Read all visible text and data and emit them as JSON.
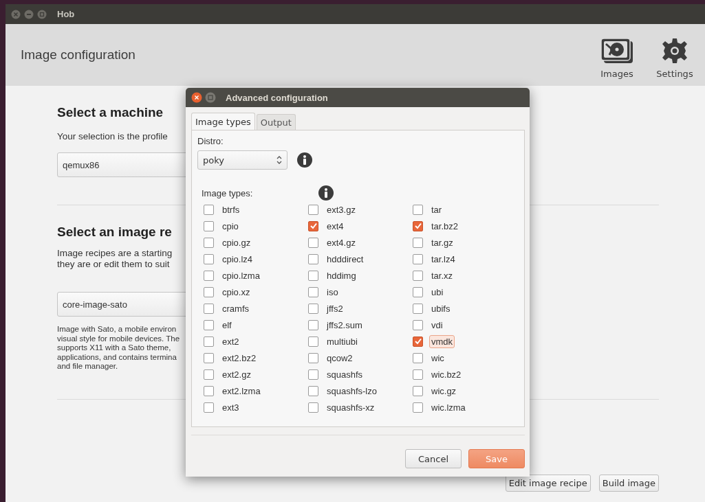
{
  "window": {
    "title": "Hob"
  },
  "header": {
    "title": "Image configuration",
    "tools": [
      {
        "label": "Images",
        "kind": "images"
      },
      {
        "label": "Settings",
        "kind": "settings"
      }
    ]
  },
  "machine": {
    "heading": "Select a machine",
    "text": "Your selection is the profile",
    "value": "qemux86"
  },
  "recipe": {
    "heading": "Select an image re",
    "text_lines": [
      "Image recipes are a starting",
      "they are or edit them to suit"
    ],
    "value": "core-image-sato",
    "description_lines": [
      "Image with Sato, a mobile environ",
      "visual style for mobile devices. The",
      "supports X11 with a Sato theme,",
      "applications, and contains termina",
      "and file manager."
    ]
  },
  "buttons": [
    "Edit image recipe",
    "Build image"
  ],
  "dialog": {
    "title": "Advanced configuration",
    "tabs": [
      {
        "label": "Image types",
        "selected": true
      },
      {
        "label": "Output",
        "selected": false
      }
    ],
    "distro_label": "Distro:",
    "distro": "poky",
    "image_types_label": "Image types:",
    "image_types": [
      {
        "label": "btrfs",
        "checked": false,
        "focused": false
      },
      {
        "label": "cpio",
        "checked": false,
        "focused": false
      },
      {
        "label": "cpio.gz",
        "checked": false,
        "focused": false
      },
      {
        "label": "cpio.lz4",
        "checked": false,
        "focused": false
      },
      {
        "label": "cpio.lzma",
        "checked": false,
        "focused": false
      },
      {
        "label": "cpio.xz",
        "checked": false,
        "focused": false
      },
      {
        "label": "cramfs",
        "checked": false,
        "focused": false
      },
      {
        "label": "elf",
        "checked": false,
        "focused": false
      },
      {
        "label": "ext2",
        "checked": false,
        "focused": false
      },
      {
        "label": "ext2.bz2",
        "checked": false,
        "focused": false
      },
      {
        "label": "ext2.gz",
        "checked": false,
        "focused": false
      },
      {
        "label": "ext2.lzma",
        "checked": false,
        "focused": false
      },
      {
        "label": "ext3",
        "checked": false,
        "focused": false
      },
      {
        "label": "ext3.gz",
        "checked": false,
        "focused": false
      },
      {
        "label": "ext4",
        "checked": true,
        "focused": false
      },
      {
        "label": "ext4.gz",
        "checked": false,
        "focused": false
      },
      {
        "label": "hdddirect",
        "checked": false,
        "focused": false
      },
      {
        "label": "hddimg",
        "checked": false,
        "focused": false
      },
      {
        "label": "iso",
        "checked": false,
        "focused": false
      },
      {
        "label": "jffs2",
        "checked": false,
        "focused": false
      },
      {
        "label": "jffs2.sum",
        "checked": false,
        "focused": false
      },
      {
        "label": "multiubi",
        "checked": false,
        "focused": false
      },
      {
        "label": "qcow2",
        "checked": false,
        "focused": false
      },
      {
        "label": "squashfs",
        "checked": false,
        "focused": false
      },
      {
        "label": "squashfs-lzo",
        "checked": false,
        "focused": false
      },
      {
        "label": "squashfs-xz",
        "checked": false,
        "focused": false
      },
      {
        "label": "tar",
        "checked": false,
        "focused": false
      },
      {
        "label": "tar.bz2",
        "checked": true,
        "focused": false
      },
      {
        "label": "tar.gz",
        "checked": false,
        "focused": false
      },
      {
        "label": "tar.lz4",
        "checked": false,
        "focused": false
      },
      {
        "label": "tar.xz",
        "checked": false,
        "focused": false
      },
      {
        "label": "ubi",
        "checked": false,
        "focused": false
      },
      {
        "label": "ubifs",
        "checked": false,
        "focused": false
      },
      {
        "label": "vdi",
        "checked": false,
        "focused": false
      },
      {
        "label": "vmdk",
        "checked": true,
        "focused": true
      },
      {
        "label": "wic",
        "checked": false,
        "focused": false
      },
      {
        "label": "wic.bz2",
        "checked": false,
        "focused": false
      },
      {
        "label": "wic.gz",
        "checked": false,
        "focused": false
      },
      {
        "label": "wic.lzma",
        "checked": false,
        "focused": false
      }
    ],
    "buttons": [
      {
        "label": "Cancel",
        "kind": "normal"
      },
      {
        "label": "Save",
        "kind": "primary"
      }
    ]
  }
}
